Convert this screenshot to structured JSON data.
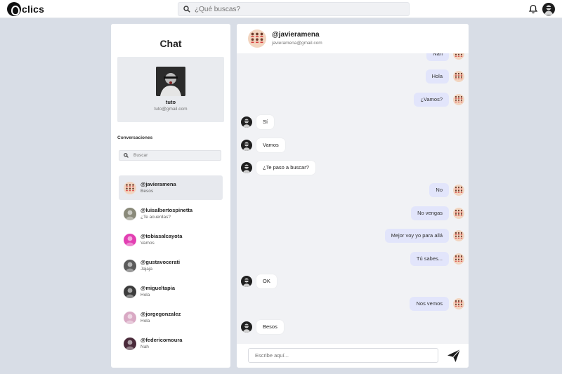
{
  "app": {
    "logo_text": "clics"
  },
  "topbar": {
    "search_placeholder": "¿Qué buscas?"
  },
  "sidebar": {
    "title": "Chat",
    "profile": {
      "name": "tuto",
      "email": "tuto@gmail.com"
    },
    "conversations_heading": "Conversaciones",
    "search_placeholder": "Buscar",
    "conversations": [
      {
        "name": "@javieramena",
        "preview": "Besos",
        "active": true,
        "avatar": "pattern"
      },
      {
        "name": "@luisalbertospinetta",
        "preview": "¿Te acuerdas?",
        "active": false,
        "avatar": "#8a8a7a"
      },
      {
        "name": "@tobiasalcayota",
        "preview": "Vamos",
        "active": false,
        "avatar": "#e23fb2"
      },
      {
        "name": "@gustavocerati",
        "preview": "Jajaja",
        "active": false,
        "avatar": "#5b5b5b"
      },
      {
        "name": "@migueltapia",
        "preview": "Hola",
        "active": false,
        "avatar": "#3c3c3c"
      },
      {
        "name": "@jorgegonzalez",
        "preview": "Hola",
        "active": false,
        "avatar": "#d9a9c4"
      },
      {
        "name": "@federicomoura",
        "preview": "Nah",
        "active": false,
        "avatar": "#4a2a3a"
      }
    ]
  },
  "chat": {
    "contact": {
      "name": "@javieramena",
      "email": "javieramena@gmail.com"
    },
    "messages": [
      {
        "dir": "out",
        "text": "Nah"
      },
      {
        "dir": "out",
        "text": "Hola"
      },
      {
        "dir": "out",
        "text": "¿Vamos?"
      },
      {
        "dir": "in",
        "text": "Sí"
      },
      {
        "dir": "in",
        "text": "Vamos"
      },
      {
        "dir": "in",
        "text": "¿Te paso a buscar?"
      },
      {
        "dir": "out",
        "text": "No"
      },
      {
        "dir": "out",
        "text": "No vengas"
      },
      {
        "dir": "out",
        "text": "Mejor voy yo para allá"
      },
      {
        "dir": "out",
        "text": "Tú sabes..."
      },
      {
        "dir": "in",
        "text": "OK"
      },
      {
        "dir": "out",
        "text": "Nos vemos"
      },
      {
        "dir": "in",
        "text": "Besos"
      }
    ],
    "composer_placeholder": "Escribe aquí..."
  },
  "colors": {
    "accent": "#e2e5fb",
    "background": "#d8dde6",
    "active_item": "#e7e9ee"
  },
  "icons": [
    "search-icon",
    "bell-icon",
    "send-icon"
  ]
}
